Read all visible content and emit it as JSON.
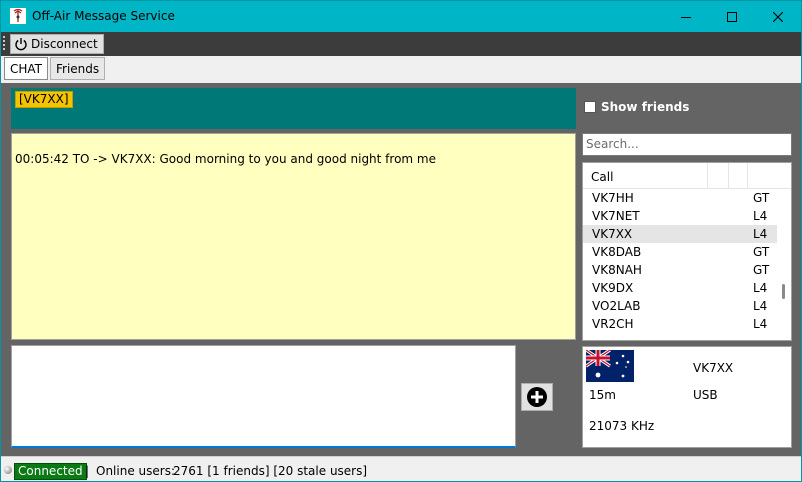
{
  "window": {
    "title": "Off-Air Message Service"
  },
  "toolbar": {
    "disconnect_label": "Disconnect"
  },
  "tabs": [
    {
      "label": "CHAT",
      "active": true
    },
    {
      "label": "Friends",
      "active": false
    }
  ],
  "chat": {
    "callsign_tag": "[VK7XX]",
    "messages": [
      "00:05:42 TO -> VK7XX: Good morning to you and good night from me"
    ],
    "compose_value": ""
  },
  "sidebar": {
    "show_friends_label": "Show friends",
    "show_friends_checked": false,
    "search_placeholder": "Search...",
    "list_header": {
      "call": "Call"
    },
    "users": [
      {
        "call": "VK7HH",
        "mode": "GT",
        "selected": false
      },
      {
        "call": "VK7NET",
        "mode": "L4",
        "selected": false
      },
      {
        "call": "VK7XX",
        "mode": "L4",
        "selected": true
      },
      {
        "call": "VK8DAB",
        "mode": "GT",
        "selected": false
      },
      {
        "call": "VK8NAH",
        "mode": "GT",
        "selected": false
      },
      {
        "call": "VK9DX",
        "mode": "L4",
        "selected": false
      },
      {
        "call": "VO2LAB",
        "mode": "L4",
        "selected": false
      },
      {
        "call": "VR2CH",
        "mode": "L4",
        "selected": false
      }
    ]
  },
  "details": {
    "flag": "australia-flag",
    "callsign": "VK7XX",
    "band": "15m",
    "mode": "USB",
    "frequency": "21073 KHz"
  },
  "status": {
    "connection": "Connected",
    "separator": "|",
    "online_label": "Online users:",
    "online_value": "2761 [1 friends] [20 stale users]"
  },
  "colors": {
    "titlebar": "#00b6c6",
    "callsign_panel": "#007878",
    "chat_bg": "#ffffc0",
    "connected_bg": "#0a7a14",
    "callsign_tag_bg": "#f5c400"
  }
}
